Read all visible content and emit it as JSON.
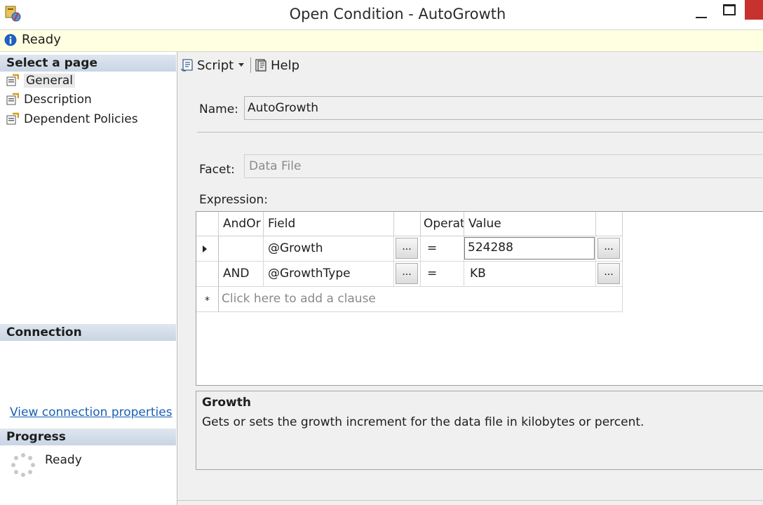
{
  "window": {
    "title": "Open Condition - AutoGrowth"
  },
  "status": {
    "text": "Ready",
    "icon": "info-icon"
  },
  "left_pane": {
    "select_page_header": "Select a page",
    "pages": [
      {
        "label": "General",
        "selected": true
      },
      {
        "label": "Description",
        "selected": false
      },
      {
        "label": "Dependent Policies",
        "selected": false
      }
    ],
    "connection_header": "Connection",
    "connection_link": "View connection properties",
    "progress_header": "Progress",
    "progress_text": "Ready"
  },
  "toolbar": {
    "script_label": "Script",
    "help_label": "Help"
  },
  "form": {
    "name_label": "Name:",
    "name_value": "AutoGrowth",
    "facet_label": "Facet:",
    "facet_value": "Data File",
    "expression_label": "Expression:"
  },
  "grid": {
    "columns": [
      "AndOr",
      "Field",
      "",
      "Operator",
      "Value",
      ""
    ],
    "rows": [
      {
        "andor": "",
        "field": "@Growth",
        "field_btn": "...",
        "operator": "=",
        "value": "524288",
        "value_btn": "..."
      },
      {
        "andor": "AND",
        "field": "@GrowthType",
        "field_btn": "...",
        "operator": "=",
        "value": "KB",
        "value_btn": "..."
      }
    ],
    "new_row_marker": "*",
    "new_row_placeholder": "Click here to add a clause"
  },
  "description": {
    "title": "Growth",
    "text": "Gets or sets the growth increment for the data file in kilobytes or percent."
  },
  "colors": {
    "status_bg": "#ffffe1",
    "section_header": "#d3dde9",
    "link": "#1a5fb4",
    "close_button": "#c7312e"
  }
}
